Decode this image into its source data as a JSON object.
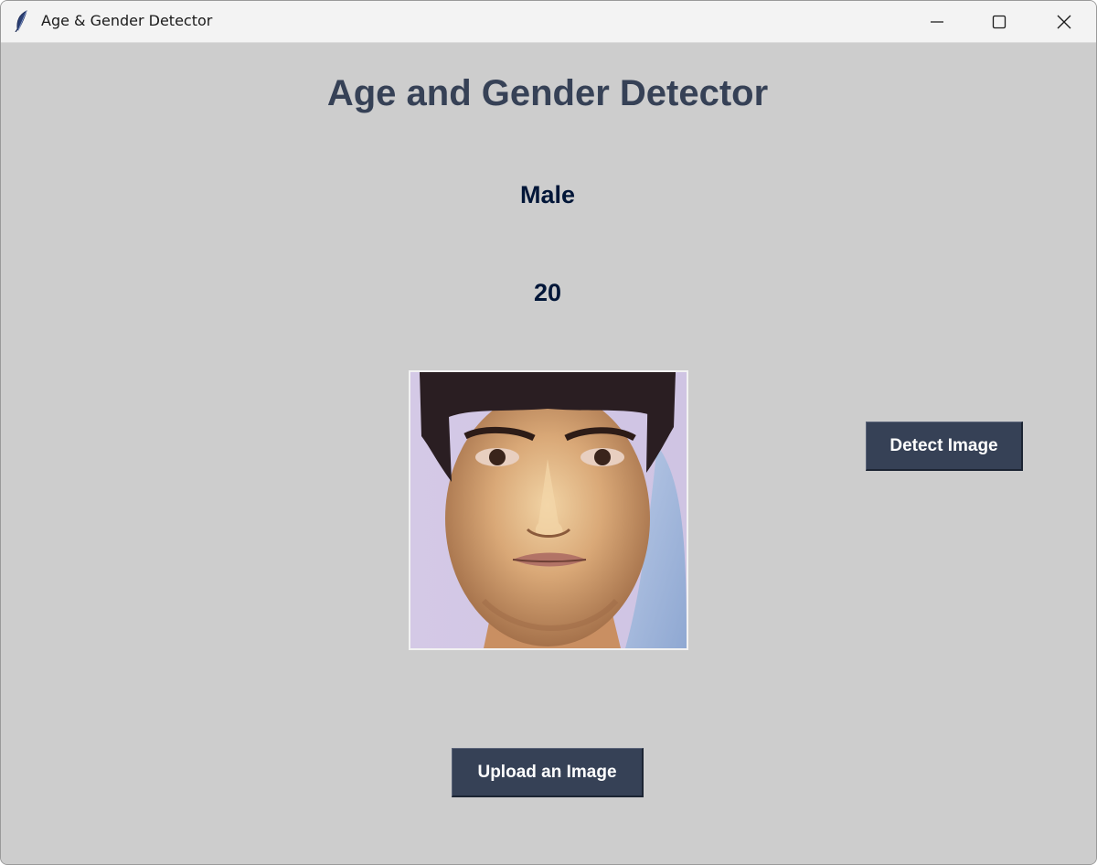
{
  "window": {
    "title": "Age & Gender Detector",
    "icon": "feather-icon",
    "controls": [
      "minimize-icon",
      "maximize-icon",
      "close-icon"
    ]
  },
  "app": {
    "heading": "Age and Gender Detector",
    "gender_result": "Male",
    "age_result": "20",
    "detect_button_label": "Detect Image",
    "upload_button_label": "Upload an Image"
  },
  "colors": {
    "background": "#cdcdcd",
    "heading": "#364156",
    "result_text": "#011638",
    "button_bg": "#364156",
    "button_text": "#ffffff"
  }
}
